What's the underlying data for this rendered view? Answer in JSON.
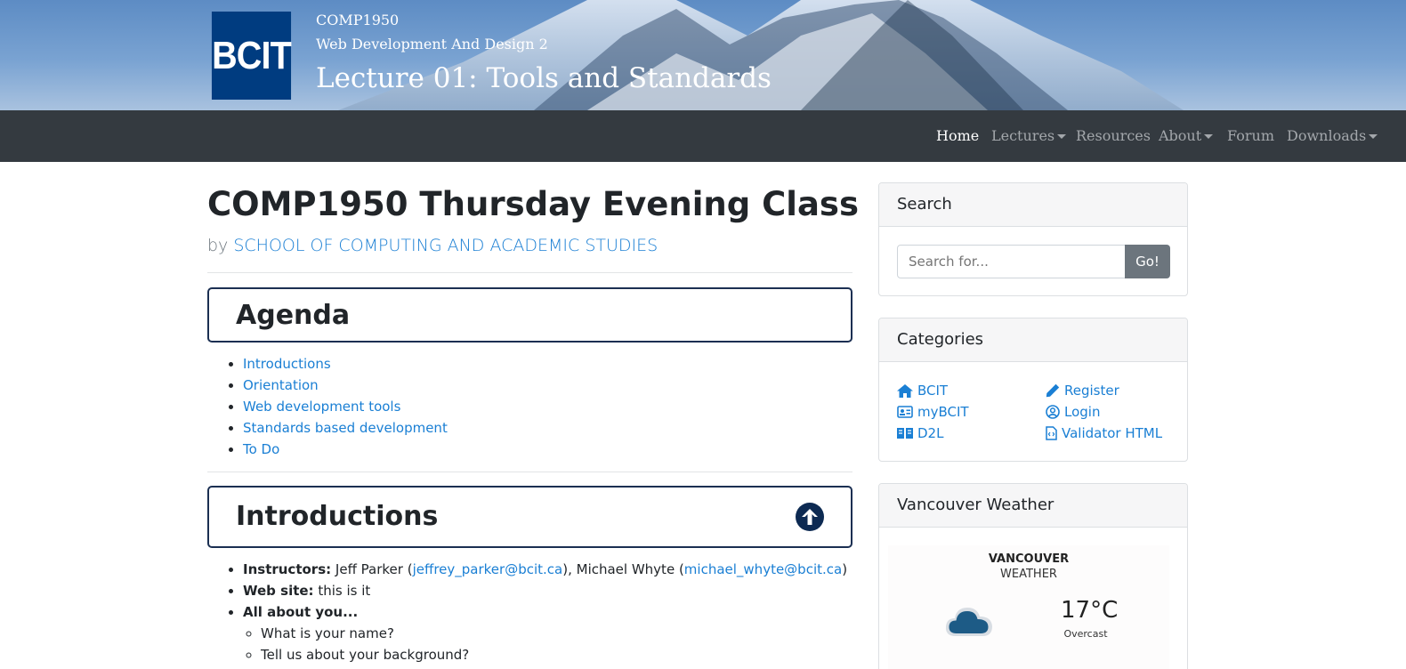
{
  "header": {
    "logo_text": "BCIT",
    "course_code": "COMP1950",
    "course_name": "Web Development And Design 2",
    "lecture_title": "Lecture 01: Tools and Standards"
  },
  "nav": {
    "items": [
      {
        "label": "Home",
        "active": true,
        "dropdown": false
      },
      {
        "label": "Lectures",
        "active": false,
        "dropdown": true
      },
      {
        "label": "Resources",
        "active": false,
        "dropdown": false
      },
      {
        "label": "About",
        "active": false,
        "dropdown": true
      },
      {
        "label": "Forum",
        "active": false,
        "dropdown": false
      },
      {
        "label": "Downloads",
        "active": false,
        "dropdown": true
      }
    ]
  },
  "main": {
    "title": "COMP1950 Thursday Evening Class",
    "by_prefix": "by",
    "author": "SCHOOL OF COMPUTING AND ACADEMIC STUDIES",
    "agenda": {
      "heading": "Agenda",
      "items": [
        "Introductions",
        "Orientation",
        "Web development tools",
        "Standards based development",
        "To Do"
      ]
    },
    "introductions": {
      "heading": "Introductions",
      "instructors_label": "Instructors:",
      "instructor1_name": "Jeff Parker",
      "instructor1_email": "jeffrey_parker@bcit.ca",
      "instructor2_name": "Michael Whyte",
      "instructor2_email": "michael_whyte@bcit.ca",
      "website_label": "Web site:",
      "website_value": "this is it",
      "about_label": "All about you...",
      "about_items": [
        "What is your name?",
        "Tell us about your background?"
      ]
    }
  },
  "sidebar": {
    "search": {
      "title": "Search",
      "placeholder": "Search for...",
      "button": "Go!"
    },
    "categories": {
      "title": "Categories",
      "left": [
        {
          "label": "BCIT",
          "icon": "home-icon"
        },
        {
          "label": "myBCIT",
          "icon": "id-card-icon"
        },
        {
          "label": "D2L",
          "icon": "book-open-icon"
        }
      ],
      "right": [
        {
          "label": "Register",
          "icon": "pencil-icon"
        },
        {
          "label": "Login",
          "icon": "user-circle-icon"
        },
        {
          "label": "Validator HTML",
          "icon": "file-code-icon"
        }
      ]
    },
    "weather": {
      "title": "Vancouver Weather",
      "city": "VANCOUVER",
      "subtitle": "WEATHER",
      "temp": "17°C",
      "condition": "Overcast",
      "icon": "cloud-icon"
    }
  },
  "colors": {
    "navbar_bg": "#343a40",
    "link": "#1a7fd4",
    "logo_bg": "#003c80",
    "section_border": "#1b2f52",
    "go_button": "#6c757d"
  }
}
